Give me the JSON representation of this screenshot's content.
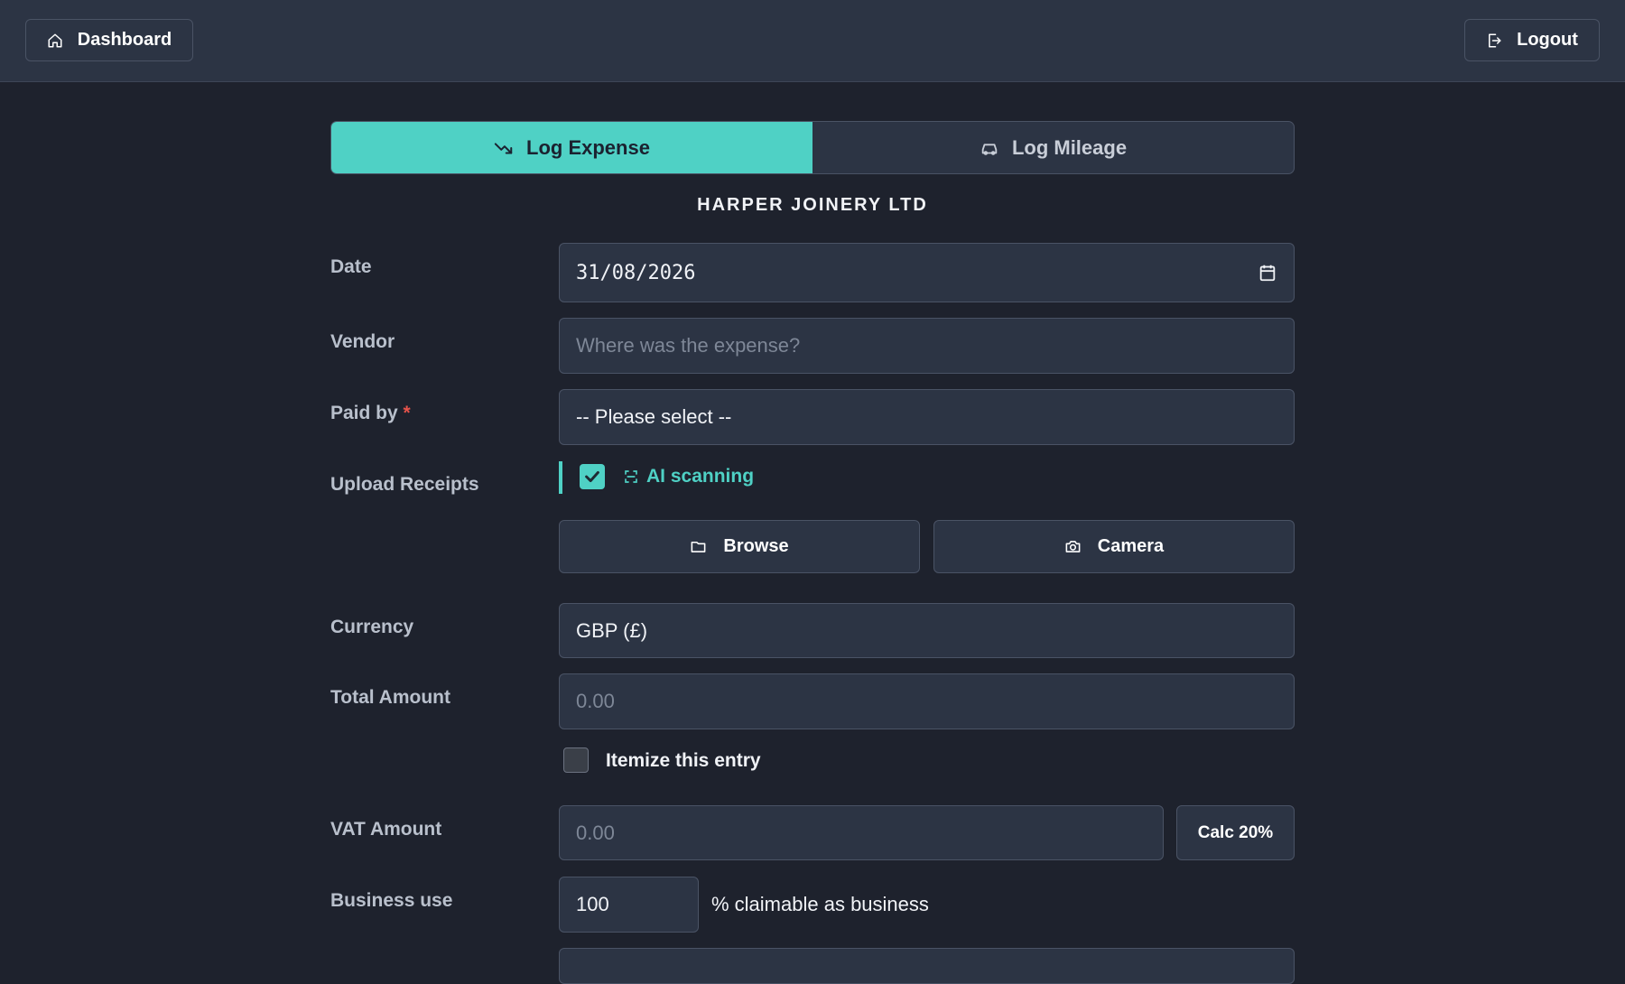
{
  "header": {
    "dashboard_label": "Dashboard",
    "logout_label": "Logout"
  },
  "tabs": [
    {
      "label": "Log Expense",
      "active": true
    },
    {
      "label": "Log Mileage",
      "active": false
    }
  ],
  "company_name": "HARPER JOINERY LTD",
  "form": {
    "date": {
      "label": "Date",
      "value": "31/08/2026"
    },
    "vendor": {
      "label": "Vendor",
      "placeholder": "Where was the expense?",
      "value": ""
    },
    "paid_by": {
      "label": "Paid by",
      "required_mark": "*",
      "value": "-- Please select --"
    },
    "upload": {
      "label": "Upload Receipts",
      "ai_scanning_label": "AI scanning",
      "ai_scanning_checked": true,
      "browse_label": "Browse",
      "camera_label": "Camera"
    },
    "currency": {
      "label": "Currency",
      "value": "GBP (£)"
    },
    "total_amount": {
      "label": "Total Amount",
      "placeholder": "0.00",
      "value": ""
    },
    "itemize": {
      "label": "Itemize this entry",
      "checked": false
    },
    "vat_amount": {
      "label": "VAT Amount",
      "placeholder": "0.00",
      "value": "",
      "calc_label": "Calc 20%"
    },
    "business_use": {
      "label": "Business use",
      "value": "100",
      "suffix": "% claimable as business"
    }
  },
  "colors": {
    "accent": "#4fd1c5",
    "background": "#1e222d",
    "surface": "#2c3444",
    "border": "#4a5365",
    "required": "#e5534b"
  }
}
